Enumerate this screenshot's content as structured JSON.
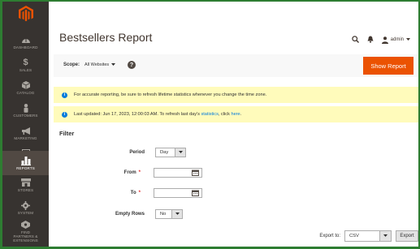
{
  "sidebar": {
    "items": [
      {
        "label": "DASHBOARD",
        "icon": "gauge-icon"
      },
      {
        "label": "SALES",
        "icon": "dollar-icon"
      },
      {
        "label": "CATALOG",
        "icon": "box-icon"
      },
      {
        "label": "CUSTOMERS",
        "icon": "person-icon"
      },
      {
        "label": "MARKETING",
        "icon": "megaphone-icon"
      },
      {
        "label": "CONTENT",
        "icon": "content-icon"
      },
      {
        "label": "REPORTS",
        "icon": "bar-chart-icon"
      },
      {
        "label": "STORES",
        "icon": "store-icon"
      },
      {
        "label": "SYSTEM",
        "icon": "gear-icon"
      },
      {
        "label": "FIND\nPARTNERS &\nEXTENSIONS",
        "icon": "partners-icon"
      }
    ]
  },
  "header": {
    "title": "Bestsellers Report",
    "admin_label": "admin"
  },
  "scope": {
    "label": "Scope:",
    "value": "All Websites",
    "show_report_label": "Show Report"
  },
  "messages": {
    "refresh_notice": "For accurate reporting, be sure to refresh lifetime statistics whenever you change the time zone.",
    "last_updated_prefix": "Last updated: Jun 17, 2023, 12:00:03 AM. To refresh last day's ",
    "statistics_link": "statistics",
    "middle": ", click ",
    "here_link": "here",
    "suffix": "."
  },
  "filter": {
    "title": "Filter",
    "period_label": "Period",
    "period_value": "Day",
    "from_label": "From",
    "from_value": "",
    "to_label": "To",
    "to_value": "",
    "required_mark": "*",
    "empty_rows_label": "Empty Rows",
    "empty_rows_value": "No"
  },
  "export": {
    "label": "Export to:",
    "format": "CSV",
    "button_label": "Export"
  },
  "colors": {
    "sidebar_bg": "#373330",
    "accent_orange": "#eb5202",
    "message_bg": "#fffbbb",
    "info_blue": "#007bdb"
  }
}
